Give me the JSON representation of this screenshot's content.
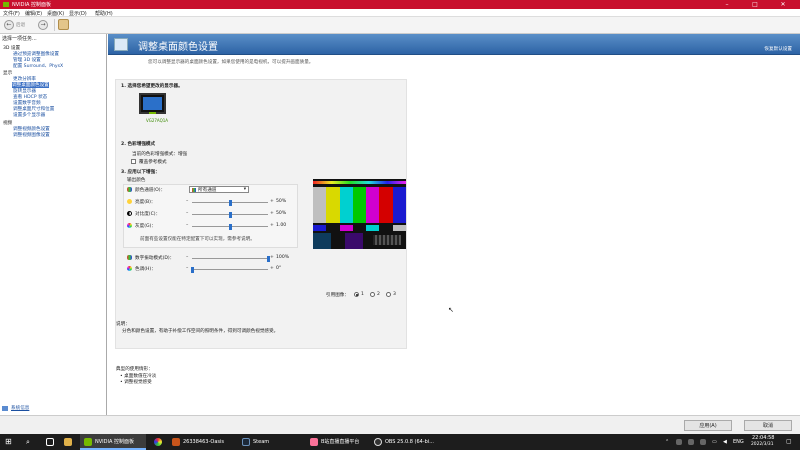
{
  "window": {
    "title": "NVIDIA 控制面板",
    "minimize": "–",
    "maximize": "□",
    "close": "✕"
  },
  "menu": {
    "file": "文件(F)",
    "edit": "编辑(E)",
    "desktop": "桌面(K)",
    "display": "显示(D)",
    "help": "帮助(H)"
  },
  "toolbar": {
    "back_label": "后退",
    "forward_label": "→"
  },
  "tree": {
    "header": "选择一项任务...",
    "items": [
      {
        "label": "3D 设置",
        "kind": "cat"
      },
      {
        "label": "通过预览调整图像设置",
        "kind": "sub"
      },
      {
        "label": "管理 3D 设置",
        "kind": "sub"
      },
      {
        "label": "配置 Surround、PhysX",
        "kind": "sub"
      },
      {
        "label": "显示",
        "kind": "cat"
      },
      {
        "label": "更改分辨率",
        "kind": "sub"
      },
      {
        "label": "调整桌面颜色设置",
        "kind": "sel"
      },
      {
        "label": "旋转显示器",
        "kind": "sub"
      },
      {
        "label": "查看 HDCP 状态",
        "kind": "sub"
      },
      {
        "label": "设置数字音频",
        "kind": "sub"
      },
      {
        "label": "调整桌面尺寸和位置",
        "kind": "sub"
      },
      {
        "label": "设置多个显示器",
        "kind": "sub"
      },
      {
        "label": "视频",
        "kind": "cat"
      },
      {
        "label": "调整视频颜色设置",
        "kind": "sub"
      },
      {
        "label": "调整视频图像设置",
        "kind": "sub"
      }
    ],
    "sysinfo_link": "系统信息"
  },
  "page": {
    "title": "调整桌面颜色设置",
    "restore_defaults": "恢复默认设置",
    "intro": "您可以调整显示器的桌面颜色设置，如果您使用的是电视机，可以提升画面质量。",
    "step1": "1. 选择您希望更改的显示器。",
    "monitor_label": "VG27AQ1A",
    "step2": "2. 色彩增强模式",
    "current_mode": "当前的色彩增强模式：增强",
    "override_ref": "覆盖参考模式",
    "step3": "3. 应用以下增强：",
    "output_color": "输出颜色",
    "color_channel_label": "颜色通道(O)：",
    "color_channel_value": "所有通道",
    "brightness_label": "亮度(B)：",
    "brightness_value": "50%",
    "contrast_label": "对比度(C)：",
    "contrast_value": "50%",
    "gamma_label": "灰度(G)：",
    "gamma_value": "1.00",
    "hint": "前面有些设置仅能在特定配置下可以实现，需参考说明。",
    "digital_vibrance_label": "数字振动模式(D)：",
    "digital_vibrance_value": "100%",
    "hue_label": "色调(H)：",
    "hue_value": "0°",
    "reference_image": "引用图像：",
    "radio_1": "1",
    "radio_2": "2",
    "radio_3": "3",
    "desc_heading": "说明：",
    "desc_text": "分色和颜色设置，有助于补偿工作空间的照明条件，得到可调颜色视觉感受。",
    "scenarios_heading": "典型的使用情形：",
    "scenario_1": "• 桌面数值在冷淡",
    "scenario_2": "• 调整视觉感受"
  },
  "levels": {
    "brightness": 0.5,
    "contrast": 0.5,
    "gamma": 0.5,
    "digital_vibrance": 1.0,
    "hue": 0.0
  },
  "buttons": {
    "apply": "应用(A)",
    "cancel": "取消"
  },
  "taskbar": {
    "start": "⊞",
    "apps": [
      "NVIDIA 控制面板",
      "26338463-Oasis",
      "Steam",
      "B站直播直播平台",
      "OBS 25.0.8 (64-bi..."
    ],
    "lang": "ENG",
    "time": "22:04:58",
    "date": "2022/3/31"
  },
  "colors": {
    "accent": "#76b900",
    "brand_red": "#c8102e",
    "selection": "#3a6fc4"
  }
}
